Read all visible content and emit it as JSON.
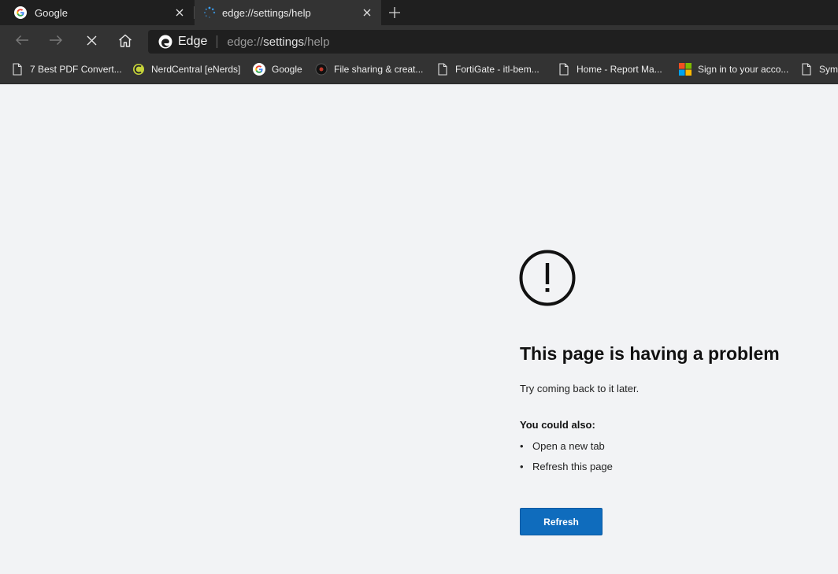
{
  "tabs": [
    {
      "title": "Google",
      "favicon": "google-g-icon",
      "active": false
    },
    {
      "title": "edge://settings/help",
      "favicon": "loading-spinner-icon",
      "active": true
    }
  ],
  "toolbar": {
    "back": "back-arrow-icon",
    "forward": "forward-arrow-icon",
    "stop": "stop-x-icon",
    "home": "home-icon"
  },
  "omnibox": {
    "brand": "Edge",
    "url_prefix": "edge://",
    "url_host": "settings",
    "url_path": "/help"
  },
  "bookmarks": [
    {
      "label": "7 Best PDF Convert...",
      "icon": "page-icon"
    },
    {
      "label": "NerdCentral [eNerds]",
      "icon": "nerdcentral-icon"
    },
    {
      "label": "Google",
      "icon": "google-g-icon"
    },
    {
      "label": "File sharing & creat...",
      "icon": "circle-logo-icon"
    },
    {
      "label": "FortiGate - itl-bem...",
      "icon": "page-icon"
    },
    {
      "label": "Home - Report Ma...",
      "icon": "page-icon"
    },
    {
      "label": "Sign in to your acco...",
      "icon": "microsoft-logo-icon"
    },
    {
      "label": "Syma",
      "icon": "page-icon"
    }
  ],
  "error": {
    "heading": "This page is having a problem",
    "subtext": "Try coming back to it later.",
    "also_label": "You could also:",
    "suggestions": [
      "Open a new tab",
      "Refresh this page"
    ],
    "button": "Refresh"
  },
  "colors": {
    "accent": "#0f6cbd",
    "tab_bg": "#1f1f1f",
    "toolbar_bg": "#333333",
    "page_bg": "#f2f3f5"
  }
}
